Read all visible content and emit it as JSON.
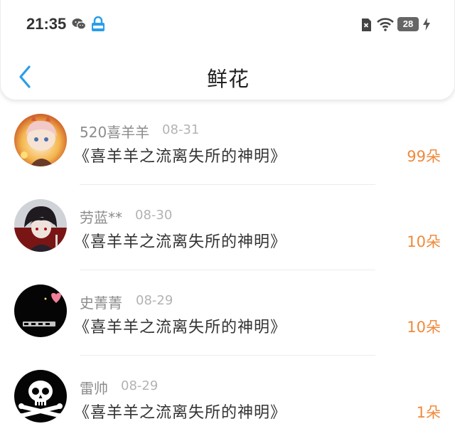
{
  "status_bar": {
    "time": "21:35",
    "battery": "28",
    "icons": [
      "wechat-icon",
      "lock-icon",
      "sim-icon",
      "wifi-icon",
      "battery-icon",
      "bolt-icon"
    ]
  },
  "header": {
    "title": "鲜花",
    "back_icon": "chevron-left-icon"
  },
  "colors": {
    "accent_blue": "#2a9ee8",
    "amount_orange": "#f08a3c",
    "name_gray": "#8c8c8c",
    "date_gray": "#b3b3b3"
  },
  "items": [
    {
      "name": "520喜羊羊",
      "date": "08-31",
      "book": "《喜羊羊之流离失所的神明》",
      "amount": "99朵"
    },
    {
      "name": "劳蓝**",
      "date": "08-30",
      "book": "《喜羊羊之流离失所的神明》",
      "amount": "10朵"
    },
    {
      "name": "史菁菁",
      "date": "08-29",
      "book": "《喜羊羊之流离失所的神明》",
      "amount": "10朵"
    },
    {
      "name": "雷帅",
      "date": "08-29",
      "book": "《喜羊羊之流离失所的神明》",
      "amount": "1朵"
    }
  ]
}
